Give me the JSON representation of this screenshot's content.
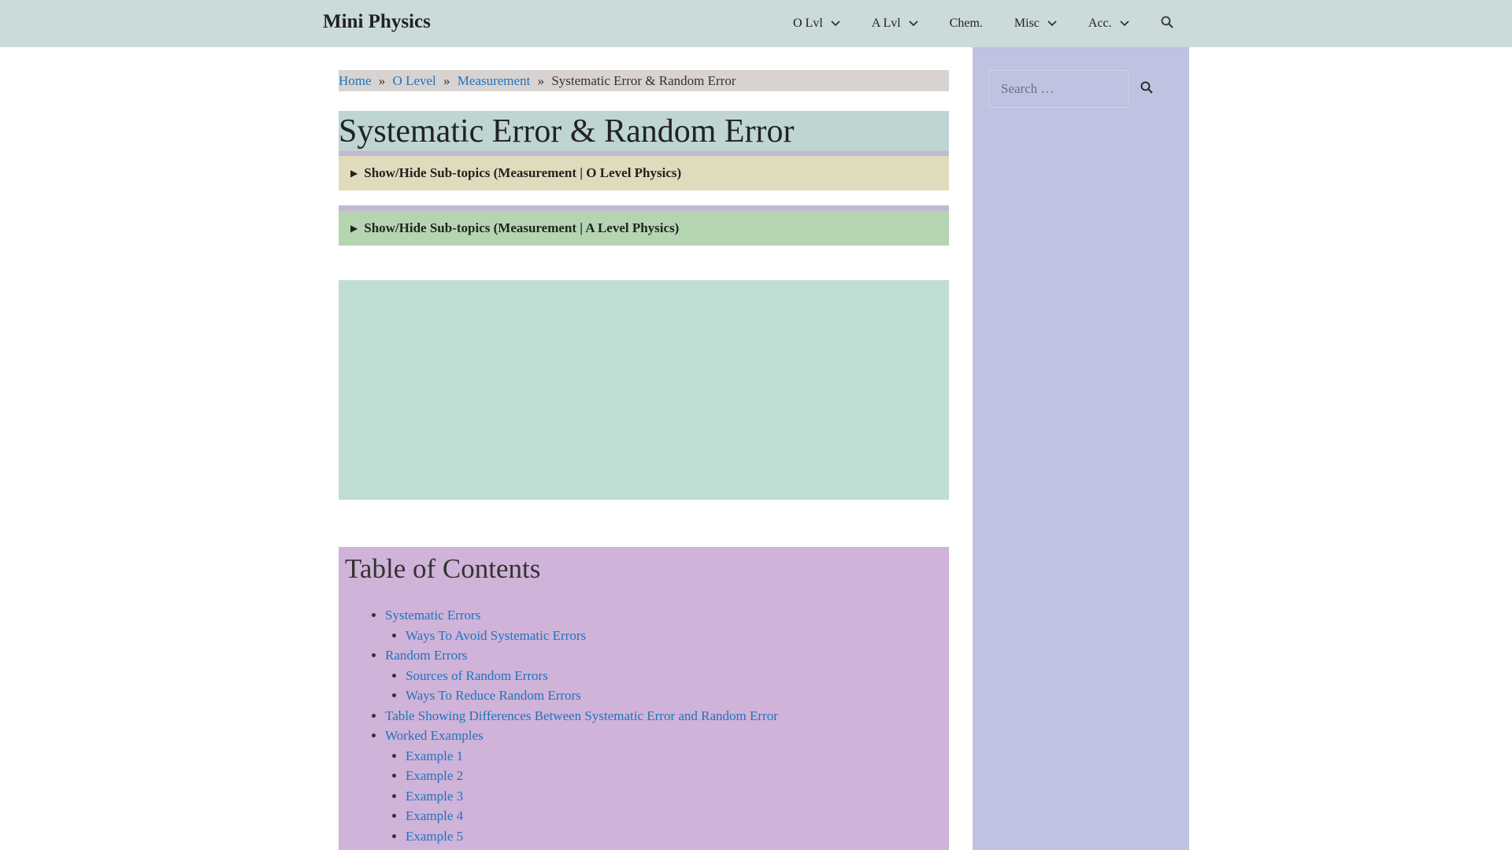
{
  "header": {
    "brand": "Mini Physics",
    "nav": [
      {
        "label": "O Lvl",
        "has_dropdown": true
      },
      {
        "label": "A Lvl",
        "has_dropdown": true
      },
      {
        "label": "Chem.",
        "has_dropdown": false
      },
      {
        "label": "Misc",
        "has_dropdown": true
      },
      {
        "label": "Acc.",
        "has_dropdown": true
      }
    ],
    "search_icon": "search-icon"
  },
  "breadcrumb": {
    "items": [
      "Home",
      "O Level",
      "Measurement"
    ],
    "current": "Systematic Error & Random Error",
    "separator": "»"
  },
  "page": {
    "title": "Systematic Error & Random Error"
  },
  "subtopics": {
    "o_level": "Show/Hide Sub-topics (Measurement | O Level Physics)",
    "a_level": "Show/Hide Sub-topics (Measurement | A Level Physics)"
  },
  "toc": {
    "title": "Table of Contents",
    "items": [
      {
        "label": "Systematic Errors",
        "children": [
          "Ways To Avoid Systematic Errors"
        ]
      },
      {
        "label": "Random Errors",
        "children": [
          "Sources of Random Errors",
          "Ways To Reduce Random Errors"
        ]
      },
      {
        "label": "Table Showing Differences Between Systematic Error and Random Error",
        "children": []
      },
      {
        "label": "Worked Examples",
        "children": [
          "Example 1",
          "Example 2",
          "Example 3",
          "Example 4",
          "Example 5"
        ]
      }
    ]
  },
  "sidebar": {
    "search_placeholder": "Search …"
  },
  "colors": {
    "header_bg": "#cadbd9",
    "link": "#1e73be",
    "sidebar_bg": "#bfc2e1",
    "toc_bg": "#d0b3d8"
  }
}
